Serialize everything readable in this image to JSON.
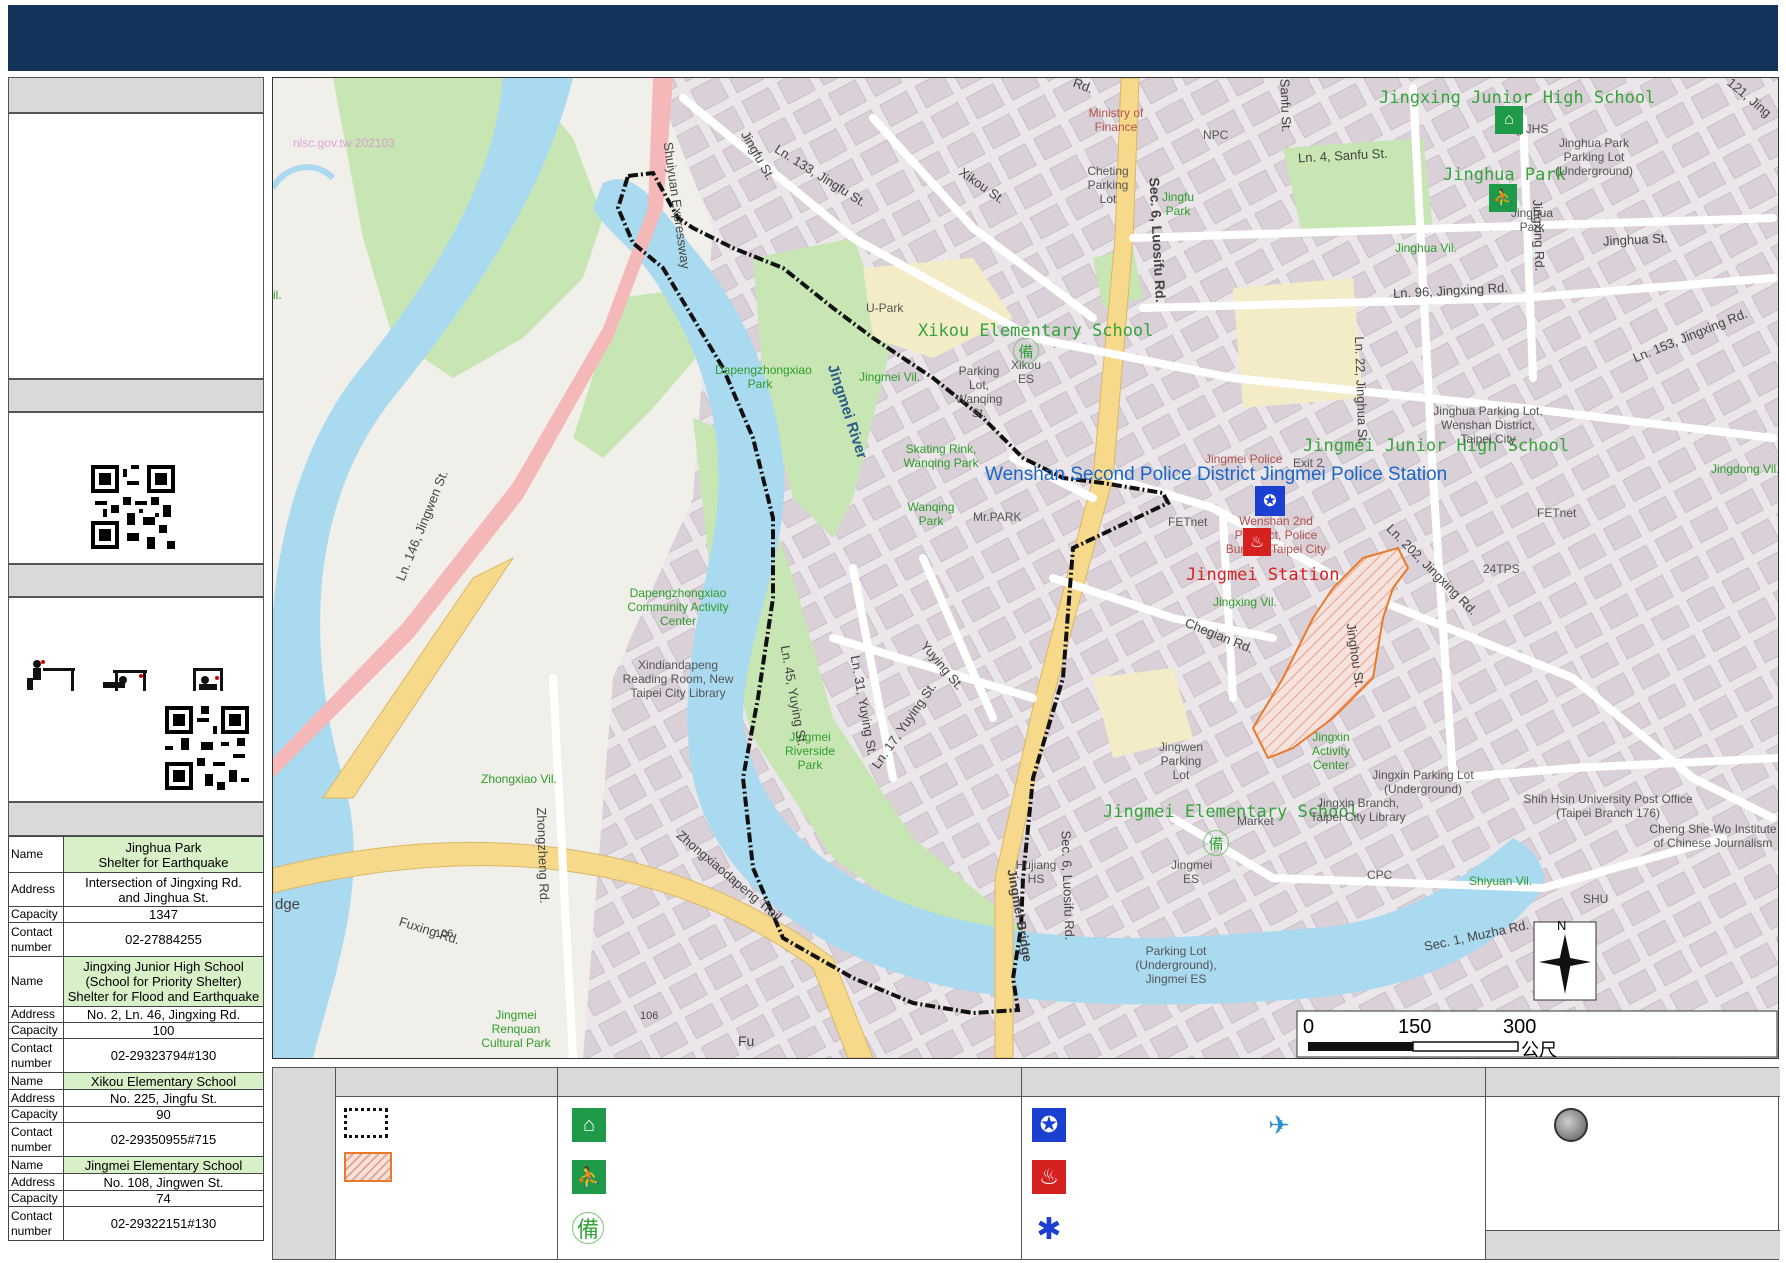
{
  "map": {
    "watermark": "nlsc.gov.tw 202103",
    "labels": {
      "schools": [
        {
          "id": "jingxing-jhs",
          "text": "Jingxing Junior High School"
        },
        {
          "id": "jinghua-park",
          "text": "Jinghua Park"
        },
        {
          "id": "xikou-es",
          "text": "Xikou Elementary School"
        },
        {
          "id": "jingmei-jhs",
          "text": "Jingmei Junior High School"
        },
        {
          "id": "jingmei-es",
          "text": "Jingmei Elementary School"
        }
      ],
      "police": "Wenshan Second Police District Jingmei Police Station",
      "station": "Jingmei Station",
      "river": "Jingmei River",
      "pois": [
        {
          "id": "ministry",
          "text": "Ministry of Finance"
        },
        {
          "id": "npc",
          "text": "NPC"
        },
        {
          "id": "cheting",
          "text": "Cheting Parking Lot"
        },
        {
          "id": "jingfu",
          "text": "Jingfu Park"
        },
        {
          "id": "jinghua-parking",
          "text": "Jinghua Park Parking Lot (Underground)"
        },
        {
          "id": "jinghua-small",
          "text": "Jinghua Park"
        },
        {
          "id": "jhs-small",
          "text": "ng JHS"
        },
        {
          "id": "upark",
          "text": "U-Park"
        },
        {
          "id": "xikou-parking",
          "text": "Parking Lot, Wanqing St."
        },
        {
          "id": "xikou-small",
          "text": "Xikou ES"
        },
        {
          "id": "dapeng",
          "text": "Dapengzhongxiao Park"
        },
        {
          "id": "skating",
          "text": "Skating Rink, Wanqing Park"
        },
        {
          "id": "wanqing",
          "text": "Wanqing Park"
        },
        {
          "id": "mrpark",
          "text": "Mr.PARK"
        },
        {
          "id": "fetnet",
          "text": "FETnet"
        },
        {
          "id": "fetnet2",
          "text": "FETnet"
        },
        {
          "id": "police-small",
          "text": "Jingmei Police"
        },
        {
          "id": "exit2",
          "text": "Exit 2"
        },
        {
          "id": "wenshan2",
          "text": "Wenshan 2nd Precinct, Police Bureau, Taipei City"
        },
        {
          "id": "jinghua-parking2",
          "text": "Jinghua Parking Lot, Wenshan District, Taipei City"
        },
        {
          "id": "24tps",
          "text": "24TPS"
        },
        {
          "id": "community",
          "text": "Dapengzhongxiao Community Activity Center"
        },
        {
          "id": "library",
          "text": "Xindiandapeng Reading Room, New Taipei City Library"
        },
        {
          "id": "riverside",
          "text": "Jingmei Riverside Park"
        },
        {
          "id": "jingwen-parking",
          "text": "Jingwen Parking Lot"
        },
        {
          "id": "jingxin",
          "text": "Jingxin Activity Center"
        },
        {
          "id": "jingxin-parking",
          "text": "Jingxin Parking Lot (Underground)"
        },
        {
          "id": "jingxin-library",
          "text": "Jingxin Branch, Taipei City Library"
        },
        {
          "id": "market",
          "text": "Market"
        },
        {
          "id": "hujiang",
          "text": "Hujiang HS"
        },
        {
          "id": "jingmei-es-small",
          "text": "Jingmei ES"
        },
        {
          "id": "cpc",
          "text": "CPC"
        },
        {
          "id": "shih-hsin",
          "text": "Shih Hsin University Post Office (Taipei Branch 176)"
        },
        {
          "id": "cheng",
          "text": "Cheng She-Wo Institute of Chinese Journalism"
        },
        {
          "id": "shu",
          "text": "SHU"
        },
        {
          "id": "parking-ug",
          "text": "Parking Lot (Underground), Jingmei ES"
        },
        {
          "id": "renquan",
          "text": "Jingmei Renquan Cultural Park"
        }
      ],
      "roads": [
        {
          "id": "ln133",
          "text": "Ln. 133, Jingfu St."
        },
        {
          "id": "jingfu-st",
          "text": "Jingfu St."
        },
        {
          "id": "xikou-st",
          "text": "Xikou St."
        },
        {
          "id": "luosifu",
          "text": "Sec. 6, Luosifu Rd."
        },
        {
          "id": "sanfu",
          "text": "Sanfu St."
        },
        {
          "id": "ln4",
          "text": "Ln. 4, Sanfu St."
        },
        {
          "id": "jingxing-rd",
          "text": "Jingxing Rd."
        },
        {
          "id": "jinghua-st",
          "text": "Jinghua St."
        },
        {
          "id": "ln96",
          "text": "Ln. 96, Jingxing Rd."
        },
        {
          "id": "ln22",
          "text": "Ln. 22, Jinghua St."
        },
        {
          "id": "ln153",
          "text": "Ln. 153, Jingxing Rd."
        },
        {
          "id": "ln146",
          "text": "Ln. 146, Jingwen St."
        },
        {
          "id": "shuiyuan",
          "text": "Shuiyuan Expressway"
        },
        {
          "id": "ln45",
          "text": "Ln. 45, Yuying St."
        },
        {
          "id": "ln31",
          "text": "Ln. 31, Yuying St."
        },
        {
          "id": "ln17",
          "text": "Ln. 17, Yuying St."
        },
        {
          "id": "yuying",
          "text": "Yuying St."
        },
        {
          "id": "ln202",
          "text": "Ln. 202, Jingxing Rd."
        },
        {
          "id": "jinghou",
          "text": "Jinghou St."
        },
        {
          "id": "chegian",
          "text": "Chegian Rd."
        },
        {
          "id": "zhongzheng",
          "text": "Zhongzheng Rd."
        },
        {
          "id": "fuxing",
          "text": "Fuxing Rd."
        },
        {
          "id": "trail",
          "text": "Zhongxiaodapeng Trail"
        },
        {
          "id": "muzha",
          "text": "Sec. 1, Muzha Rd."
        },
        {
          "id": "bridge",
          "text": "Jingmei Bridge"
        },
        {
          "id": "luosifu2",
          "text": "Sec. 6, Luosifu Rd."
        },
        {
          "id": "r106a",
          "text": "106"
        },
        {
          "id": "r106b",
          "text": "106"
        },
        {
          "id": "edge",
          "text": "dge"
        },
        {
          "id": "rd-top",
          "text": "Rd."
        },
        {
          "id": "r121",
          "text": "121, Jing"
        },
        {
          "id": "fu",
          "text": "Fu"
        }
      ],
      "villages": [
        {
          "id": "jinghua-vil",
          "text": "Jinghua Vil."
        },
        {
          "id": "jingmei-vil",
          "text": "Jingmei Vil."
        },
        {
          "id": "jingxing-vil",
          "text": "Jingxing Vil."
        },
        {
          "id": "zhongxiao-vil",
          "text": "Zhongxiao Vil."
        },
        {
          "id": "shiyuan-vil",
          "text": "Shiyuan Vil."
        },
        {
          "id": "jingdong-vil",
          "text": "Jingdong Vil."
        },
        {
          "id": "vil-left",
          "text": "il."
        }
      ]
    },
    "scale": {
      "ticks": [
        "0",
        "150",
        "300"
      ],
      "unit": "公尺"
    },
    "compass": "N"
  },
  "shelters": [
    {
      "rows": [
        {
          "label": "Name",
          "value": "Jinghua Park\nShelter for Earthquake",
          "highlight": true
        },
        {
          "label": "Address",
          "value": "Intersection of Jingxing Rd.\nand Jinghua St."
        },
        {
          "label": "Capacity",
          "value": "1347"
        },
        {
          "label": "Contact number",
          "value": "02-27884255"
        }
      ]
    },
    {
      "rows": [
        {
          "label": "Name",
          "value": "Jingxing Junior High School\n(School for Priority Shelter)\nShelter for Flood and Earthquake",
          "highlight": true
        },
        {
          "label": "Address",
          "value": "No. 2, Ln. 46, Jingxing Rd."
        },
        {
          "label": "Capacity",
          "value": "100"
        },
        {
          "label": "Contact number",
          "value": "02-29323794#130"
        }
      ]
    },
    {
      "rows": [
        {
          "label": "Name",
          "value": "Xikou Elementary School",
          "highlight": true
        },
        {
          "label": "Address",
          "value": "No. 225, Jingfu St."
        },
        {
          "label": "Capacity",
          "value": "90"
        },
        {
          "label": "Contact number",
          "value": "02-29350955#715"
        }
      ]
    },
    {
      "rows": [
        {
          "label": "Name",
          "value": "Jingmei Elementary School",
          "highlight": true
        },
        {
          "label": "Address",
          "value": "No. 108, Jingwen St."
        },
        {
          "label": "Capacity",
          "value": "74"
        },
        {
          "label": "Contact number",
          "value": "02-29322151#130"
        }
      ]
    }
  ],
  "legend": {
    "backup_glyph": "備",
    "icons": [
      "boundary-swatch",
      "hazard-swatch",
      "shelter-school-icon",
      "shelter-park-icon",
      "backup-shelter-icon",
      "police-icon",
      "fire-station-icon",
      "medical-icon",
      "helicopter-icon",
      "gauge-icon"
    ]
  },
  "colors": {
    "header": "#13335a",
    "water": "#aadaf0",
    "park": "#c8e6b4",
    "road": "#f6d98a",
    "shelter_green": "#1e9a48",
    "police_blue": "#1a3fd1",
    "fire_red": "#d62121",
    "hazard": "#e87a2b"
  }
}
